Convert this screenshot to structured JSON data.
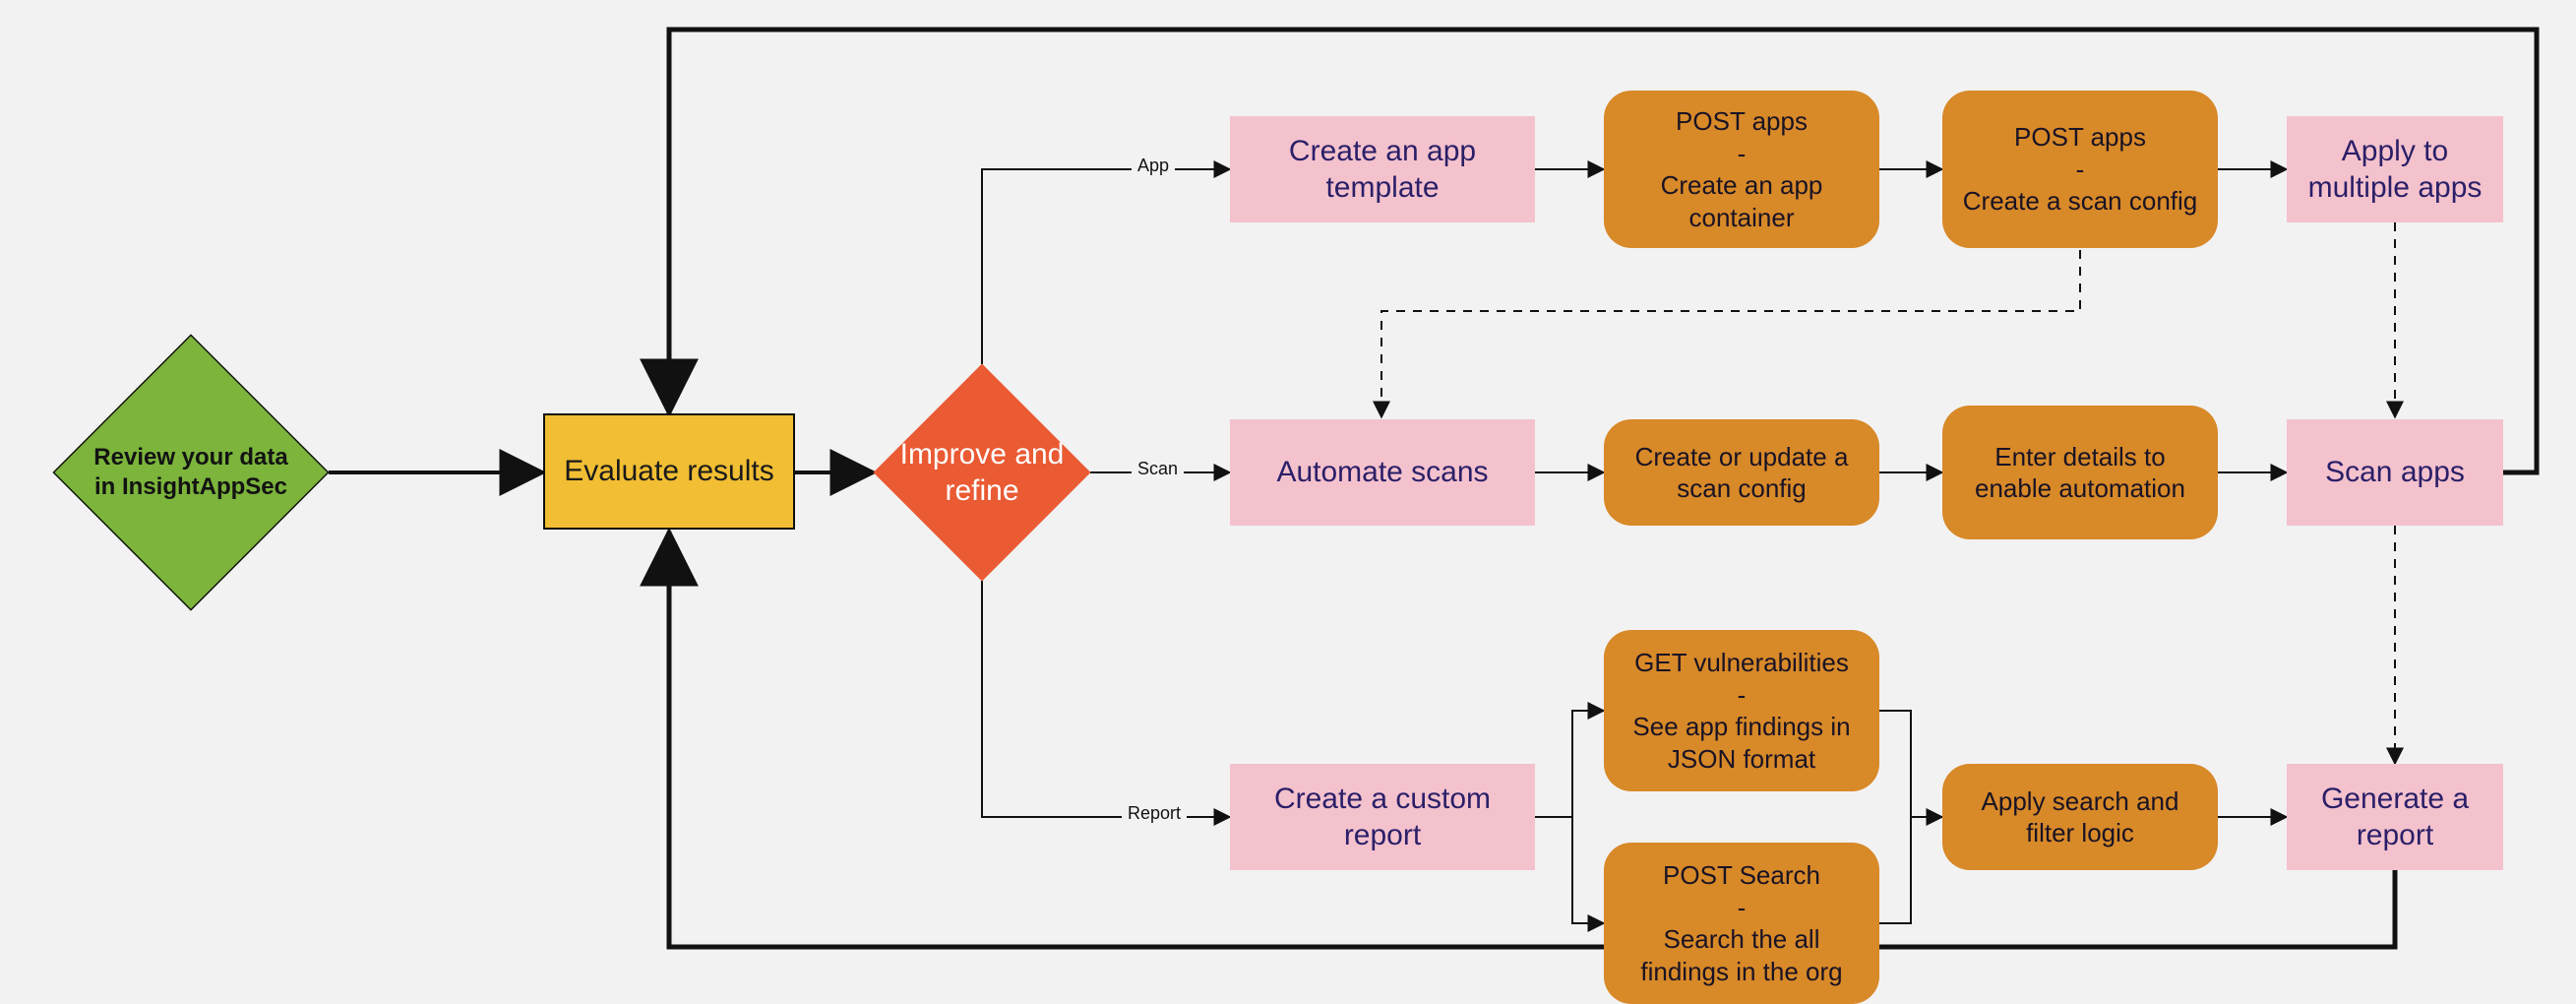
{
  "diagram": {
    "review": "Review your data in InsightAppSec",
    "evaluate": "Evaluate results",
    "improve": "Improve and refine",
    "app_row": {
      "label": "App",
      "create_template": "Create an app template",
      "post_apps_container": "POST apps\n-\nCreate an app container",
      "post_apps_scanconfig": "POST apps\n-\nCreate a scan config",
      "apply_multiple": "Apply to multiple apps"
    },
    "scan_row": {
      "label": "Scan",
      "automate": "Automate scans",
      "create_update_config": "Create or update a scan config",
      "enter_details": "Enter details to enable automation",
      "scan_apps": "Scan apps"
    },
    "report_row": {
      "label": "Report",
      "create_custom": "Create a custom report",
      "get_vuln": "GET vulnerabilities\n-\nSee app findings in JSON format",
      "post_search": "POST Search\n-\nSearch the all findings in the org",
      "apply_filter": "Apply search and filter logic",
      "generate": "Generate a report"
    }
  }
}
